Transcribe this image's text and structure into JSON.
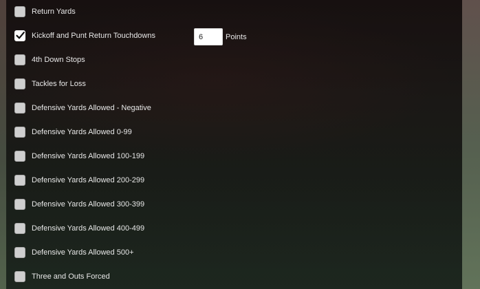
{
  "options": [
    {
      "label": "Return Yards",
      "checked": false
    },
    {
      "label": "Kickoff and Punt Return Touchdowns",
      "checked": true
    },
    {
      "label": "4th Down Stops",
      "checked": false
    },
    {
      "label": "Tackles for Loss",
      "checked": false
    },
    {
      "label": "Defensive Yards Allowed - Negative",
      "checked": false
    },
    {
      "label": "Defensive Yards Allowed 0-99",
      "checked": false
    },
    {
      "label": "Defensive Yards Allowed 100-199",
      "checked": false
    },
    {
      "label": "Defensive Yards Allowed 200-299",
      "checked": false
    },
    {
      "label": "Defensive Yards Allowed 300-399",
      "checked": false
    },
    {
      "label": "Defensive Yards Allowed 400-499",
      "checked": false
    },
    {
      "label": "Defensive Yards Allowed 500+",
      "checked": false
    },
    {
      "label": "Three and Outs Forced",
      "checked": false
    }
  ],
  "points": {
    "value": "6",
    "label": "Points"
  }
}
